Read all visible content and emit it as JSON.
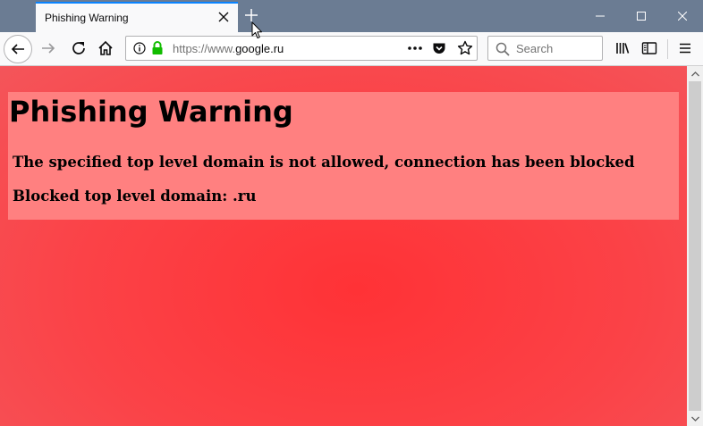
{
  "tab": {
    "title": "Phishing Warning"
  },
  "urlbar": {
    "scheme": "https://www.",
    "domain": "google.ru"
  },
  "search": {
    "placeholder": "Search"
  },
  "page": {
    "title": "Phishing Warning",
    "message": "The specified top level domain is not allowed, connection has been blocked",
    "blocked_domain": "Blocked top level domain: .ru"
  },
  "colors": {
    "page_background": "#ff3b3f",
    "warning_box": "#ff8080",
    "tab_accent": "#0a84ff",
    "titlebar": "#6b7c93",
    "lock_green": "#12bc00"
  },
  "icons": [
    "close-icon",
    "plus-icon",
    "minimize-icon",
    "maximize-icon",
    "back-arrow-icon",
    "forward-arrow-icon",
    "reload-icon",
    "home-icon",
    "info-icon",
    "lock-icon",
    "ellipsis-icon",
    "pocket-icon",
    "star-icon",
    "search-icon",
    "library-icon",
    "sidebar-icon",
    "hamburger-menu-icon",
    "mouse-cursor-icon"
  ]
}
